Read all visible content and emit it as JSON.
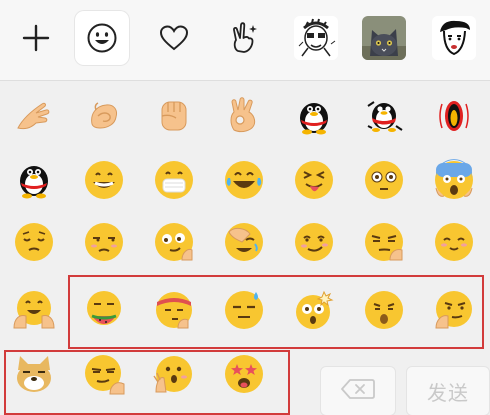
{
  "tabs": [
    {
      "icon": "plus-icon"
    },
    {
      "icon": "smiley-icon",
      "selected": true
    },
    {
      "icon": "heart-icon"
    },
    {
      "icon": "victory-hand-icon"
    },
    {
      "icon": "sticker-cartoon-man"
    },
    {
      "icon": "sticker-cat-photo"
    },
    {
      "icon": "sticker-cartoon-face"
    }
  ],
  "emoji_rows": [
    [
      "wave-hand-icon",
      "fist-hand-icon",
      "fist-icon",
      "ok-hand-icon",
      "penguin-icon",
      "penguin-dance-icon",
      "penguin-spin-icon"
    ],
    [
      "penguin-sit-icon",
      "grin-icon",
      "mask-icon",
      "tears-of-joy-icon",
      "tongue-wink-icon",
      "wide-eyes-icon",
      "scream-icon"
    ],
    [
      "pensive-icon",
      "unamused-icon",
      "thinking-smile-icon",
      "facepalm-icon",
      "smirk-icon",
      "sly-look-icon",
      "shy-smile-icon"
    ],
    [
      "clap-smile-icon",
      "melon-eater-icon",
      "headband-icon",
      "sweat-icon",
      "mind-blown-icon",
      "kiss-face-icon",
      "nose-pick-icon"
    ],
    [
      "doge-icon",
      "cool-point-icon",
      "shocked-hand-icon",
      "star-eyes-icon"
    ]
  ],
  "buttons": {
    "delete_icon": "backspace-icon",
    "send_label": "发送"
  },
  "colors": {
    "highlight": "#d23b3b",
    "emoji_yellow": "#f8c630",
    "send_text": "#c9c9c9"
  }
}
